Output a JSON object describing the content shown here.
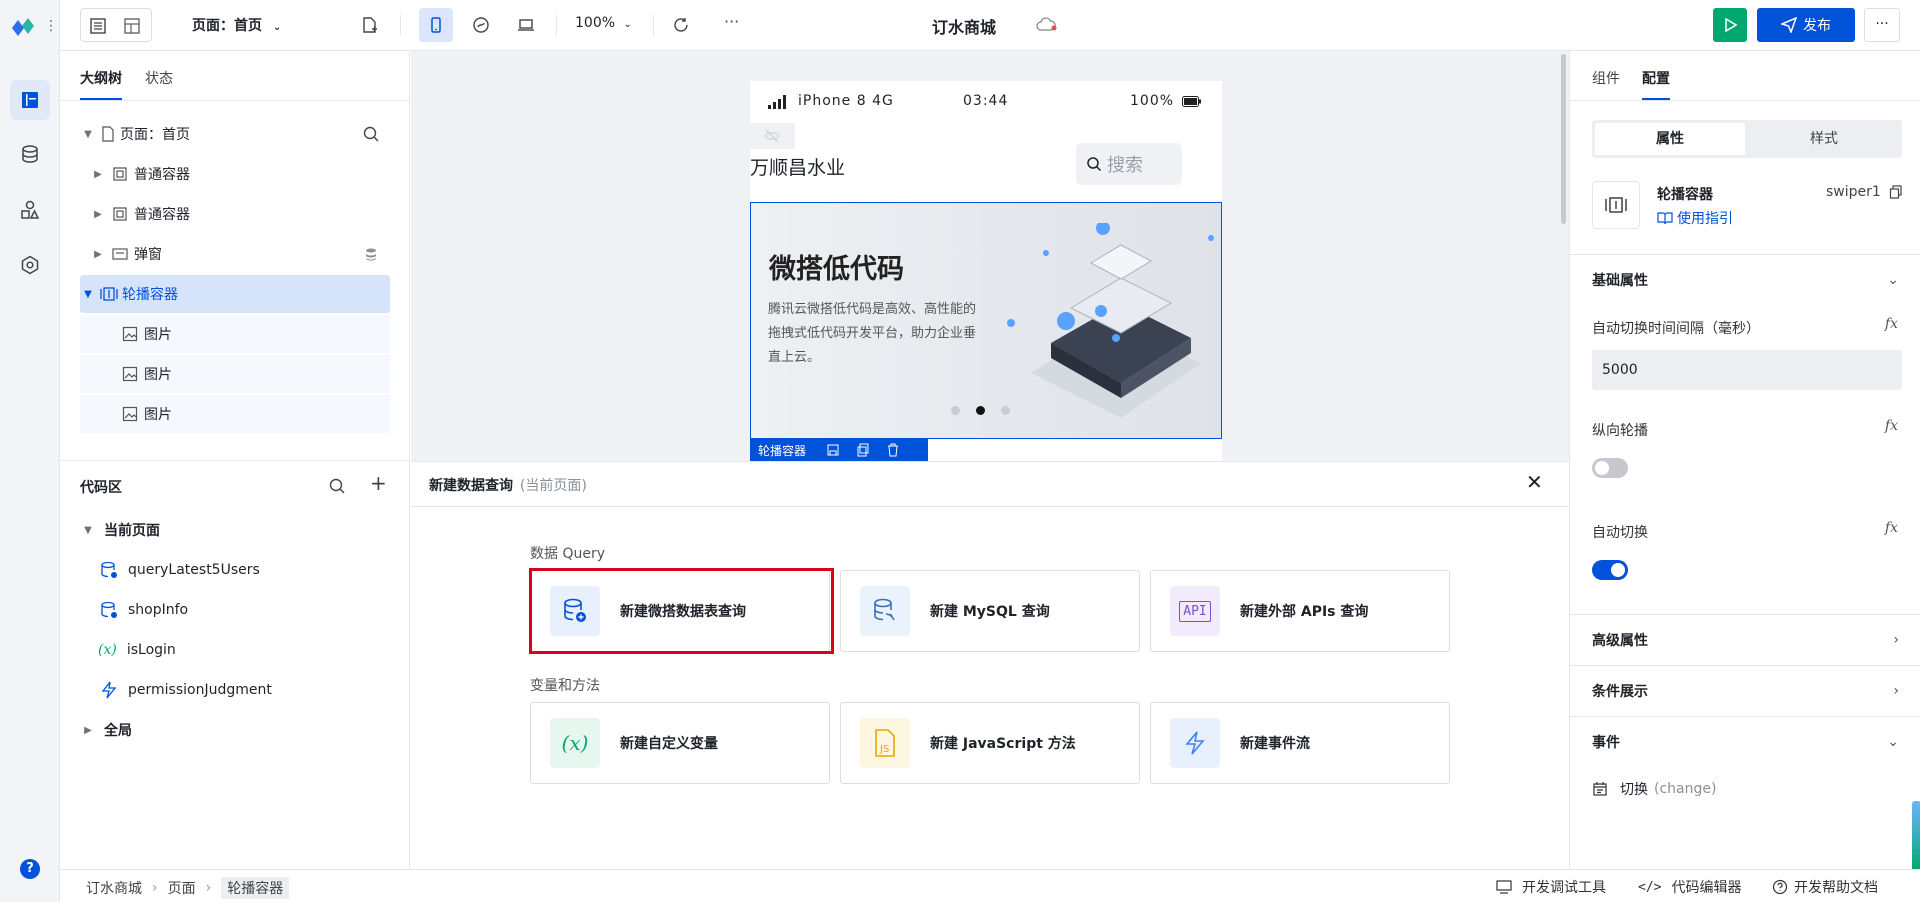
{
  "topbar": {
    "page_selector": "页面：首页",
    "zoom": "100%",
    "app_title": "订水商城",
    "publish_label": "发布",
    "more": "···"
  },
  "outline": {
    "tabs": [
      "大纲树",
      "状态"
    ],
    "root_label": "页面：首页",
    "items": [
      {
        "label": "普通容器"
      },
      {
        "label": "普通容器"
      },
      {
        "label": "弹窗"
      },
      {
        "label": "轮播容器"
      },
      {
        "label": "图片"
      },
      {
        "label": "图片"
      },
      {
        "label": "图片"
      }
    ]
  },
  "code_area": {
    "title": "代码区",
    "current_page": "当前页面",
    "items": [
      {
        "label": "queryLatest5Users",
        "icon": "database-icon"
      },
      {
        "label": "shopInfo",
        "icon": "database-icon"
      },
      {
        "label": "isLogin",
        "icon": "variable-icon"
      },
      {
        "label": "permissionJudgment",
        "icon": "event-flow-icon"
      }
    ],
    "global": "全局"
  },
  "phone": {
    "carrier": "iPhone 8  4G",
    "time": "03:44",
    "battery": "100%",
    "brand": "万顺昌水业",
    "search_placeholder": "搜索",
    "banner_title": "微搭低代码",
    "banner_text": "腾讯云微搭低代码是高效、高性能的拖拽式低代码开发平台，助力企业垂直上云。",
    "swiper_tag": "轮播容器",
    "active_dot": 1,
    "dots": 3
  },
  "dialog": {
    "title": "新建数据查询",
    "subtitle": "(当前页面)",
    "section_query": "数据 Query",
    "section_vars": "变量和方法",
    "cards": [
      {
        "label": "新建微搭数据表查询",
        "icon": "weda-db-icon"
      },
      {
        "label": "新建 MySQL 查询",
        "icon": "mysql-icon"
      },
      {
        "label": "新建外部 APIs 查询",
        "icon": "api-icon"
      },
      {
        "label": "新建自定义变量",
        "icon": "variable-icon"
      },
      {
        "label": "新建 JavaScript 方法",
        "icon": "javascript-file-icon"
      },
      {
        "label": "新建事件流",
        "icon": "event-flow-icon"
      }
    ]
  },
  "right_panel": {
    "tabs": [
      "组件",
      "配置"
    ],
    "seg": [
      "属性",
      "样式"
    ],
    "component_name": "轮播容器",
    "component_id": "swiper1",
    "guide_link": "使用指引",
    "basic_props": "基础属性",
    "interval_label": "自动切换时间间隔（毫秒）",
    "interval_value": "5000",
    "vertical_label": "纵向轮播",
    "vertical_on": false,
    "autoplay_label": "自动切换",
    "autoplay_on": true,
    "advanced": "高级属性",
    "conditional": "条件展示",
    "events": "事件",
    "event_item": "切换",
    "event_code": "(change)",
    "fx": "fx"
  },
  "statusbar": {
    "breadcrumb": [
      "订水商城",
      "页面",
      "轮播容器"
    ],
    "devtools": "开发调试工具",
    "code_editor": "代码编辑器",
    "dev_docs": "开发帮助文档"
  },
  "colors": {
    "accent": "#0052d9",
    "run_green": "#00a870",
    "highlight_red": "#d9001b"
  }
}
